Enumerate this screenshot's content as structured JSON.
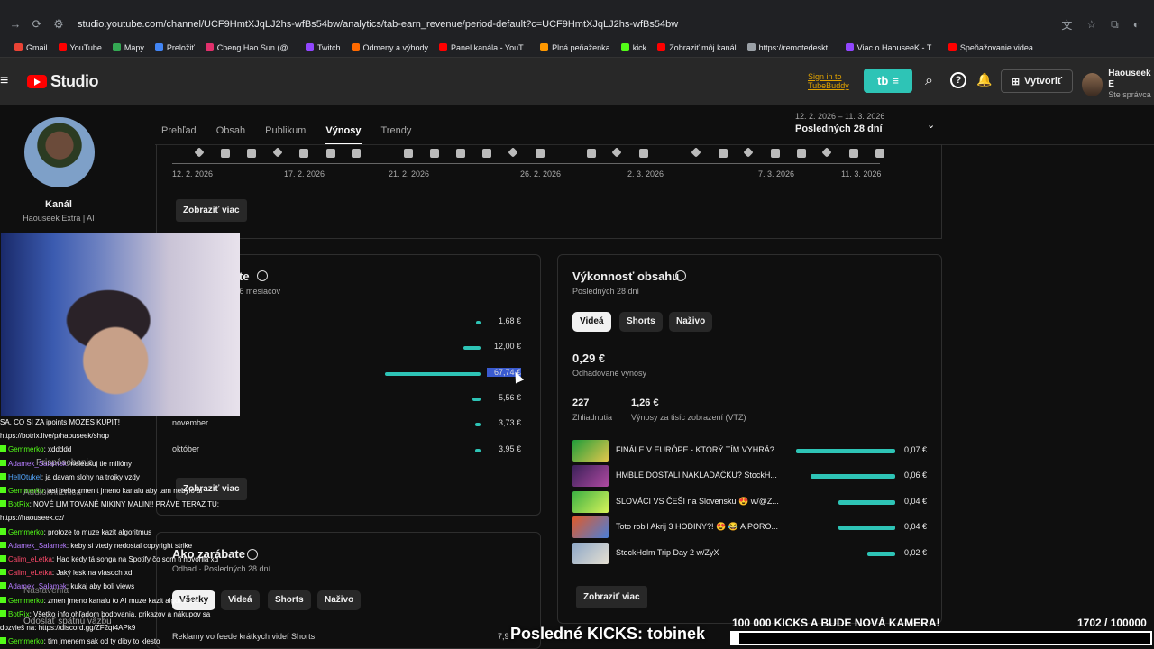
{
  "browser": {
    "url": "studio.youtube.com/channel/UCF9HmtXJqLJ2hs-wfBs54bw/analytics/tab-earn_revenue/period-default?c=UCF9HmtXJqLJ2hs-wfBs54bw",
    "bookmarks": [
      {
        "label": "Gmail",
        "color": "#ea4335"
      },
      {
        "label": "YouTube",
        "color": "#ff0000"
      },
      {
        "label": "Mapy",
        "color": "#34a853"
      },
      {
        "label": "Preložiť",
        "color": "#4285f4"
      },
      {
        "label": "Cheng Hao Sun (@...",
        "color": "#e1306c"
      },
      {
        "label": "Twitch",
        "color": "#9146ff"
      },
      {
        "label": "Odmeny a výhody",
        "color": "#ff6a00"
      },
      {
        "label": "Panel kanála - YouT...",
        "color": "#ff0000"
      },
      {
        "label": "Plná peňaženka",
        "color": "#ff9800"
      },
      {
        "label": "kick",
        "color": "#53fc18"
      },
      {
        "label": "Zobraziť môj kanál",
        "color": "#ff0000"
      },
      {
        "label": "https://remotedeskt...",
        "color": "#9aa0a6"
      },
      {
        "label": "Viac o HaouseeK - T...",
        "color": "#9146ff"
      },
      {
        "label": "Speňažovanie videa...",
        "color": "#ff0000"
      }
    ]
  },
  "header": {
    "brand": "Studio",
    "tubebuddy": "Sign in to TubeBuddy",
    "tb_label": "tb",
    "create_label": "Vytvoriť",
    "account_name": "Haouseek E",
    "account_role": "Ste správca"
  },
  "sidebar": {
    "channel_label": "Kanál",
    "channel_name": "Haouseek Extra | AI"
  },
  "tabs": [
    "Prehľad",
    "Obsah",
    "Publikum",
    "Výnosy",
    "Trendy"
  ],
  "period": {
    "range": "12. 2. 2026 – 11. 3. 2026",
    "label": "Posledných 28 dní"
  },
  "timeline": {
    "ticks": [
      "12. 2. 2026",
      "17. 2. 2026",
      "21. 2. 2026",
      "26. 2. 2026",
      "2. 3. 2026",
      "7. 3. 2026",
      "11. 3. 2026"
    ],
    "more": "Zobraziť viac"
  },
  "revenue_card": {
    "title": "te",
    "subtitle": "h 6 mesiacov",
    "rows": [
      {
        "month": "",
        "value": "1,68 €",
        "amount": 1.68
      },
      {
        "month": "",
        "value": "12,00 €",
        "amount": 12.0
      },
      {
        "month": "",
        "value": "67,74 €",
        "amount": 67.74
      },
      {
        "month": "",
        "value": "5,56 €",
        "amount": 5.56
      },
      {
        "month": "november",
        "value": "3,73 €",
        "amount": 3.73
      },
      {
        "month": "október",
        "value": "3,95 €",
        "amount": 3.95
      }
    ],
    "more": "Zobraziť viac"
  },
  "performance_card": {
    "title": "Výkonnosť obsahu",
    "subtitle": "Posledných 28 dní",
    "chips": [
      "Videá",
      "Shorts",
      "Naživo"
    ],
    "estimated_value": "0,29 €",
    "estimated_label": "Odhadované výnosy",
    "views_value": "227",
    "views_label": "Zhliadnutia",
    "rpm_value": "1,26 €",
    "rpm_label": "Výnosy za tisíc zobrazení (VTZ)",
    "videos": [
      {
        "title": "FINÁLE V EURÓPE - KTORÝ TÍM VYHRÁ? ...",
        "value": "0,07 €",
        "amount": 0.07
      },
      {
        "title": "HMBLE DOSTALI NAKLADAČKU? StockH...",
        "value": "0,06 €",
        "amount": 0.06
      },
      {
        "title": "SLOVÁCI VS ČEŠI na Slovensku 😍 w/@Z...",
        "value": "0,04 €",
        "amount": 0.04
      },
      {
        "title": "Toto robil Akrij 3 HODINY?! 😍 😂 A PORO...",
        "value": "0,04 €",
        "amount": 0.04
      },
      {
        "title": "StockHolm Trip Day 2 w/ZyX",
        "value": "0,02 €",
        "amount": 0.02
      }
    ],
    "more": "Zobraziť viac"
  },
  "earn_card": {
    "title": "Ako zarábate",
    "subtitle": "Odhad · Posledných 28 dní",
    "chips": [
      "Všetky",
      "Videá",
      "Shorts",
      "Naživo"
    ],
    "row_label": "Reklamy vo feede krátkych videí Shorts",
    "row_value": "7,9"
  },
  "chat": [
    {
      "user": "",
      "text": "SA, CO SI ZA ipoints MOZES KUPIT!",
      "color": "#ffffff"
    },
    {
      "user": "",
      "text": "https://botrix.live/p/haouseek/shop",
      "color": "#ffffff"
    },
    {
      "user": "Gemmerko",
      "text": ": xddddd",
      "color": "#53fc18"
    },
    {
      "user": "Adamek_Salamek",
      "text": ": neleakuj tie milióny",
      "color": "#b57cff"
    },
    {
      "user": "HellOtukel",
      "text": ": ja davam slohy na trojky vzdy",
      "color": "#53a7ff"
    },
    {
      "user": "Gemmerko",
      "text": ": asi treba zmenit jmeno kanalu aby tam nebylo ai",
      "color": "#53fc18"
    },
    {
      "user": "BotRix",
      "text": ": NOVÉ LIMITOVANÉ MIKINY MALIN!! PRÁVE TERAZ TU:",
      "color": "#53fc18"
    },
    {
      "user": "",
      "text": "https://haouseek.cz/",
      "color": "#ffffff"
    },
    {
      "user": "Gemmerko",
      "text": ": protoze to muze kazit algoritmus",
      "color": "#53fc18"
    },
    {
      "user": "Adamek_Salamek",
      "text": ": keby si vtedy nedostal copyright strike",
      "color": "#b57cff"
    },
    {
      "user": "Calim_eLetka",
      "text": ": Hao kedy tá songa na Spotify čo som ti hovorila xd",
      "color": "#ff4a6a"
    },
    {
      "user": "Calim_eLetka",
      "text": ": Jaký lesk na vlasoch xd",
      "color": "#ff4a6a"
    },
    {
      "user": "Adamek_Salamek",
      "text": ": kukaj aby boli views",
      "color": "#b57cff"
    },
    {
      "user": "Gemmerko",
      "text": ": zmen jmeno kanalu to AI muze kazit algoritmus",
      "color": "#53fc18"
    },
    {
      "user": "BotRix",
      "text": ": Všetko info ohľadom bodovania, prikazov a nákupov sa",
      "color": "#53fc18"
    },
    {
      "user": "",
      "text": "dozvieš na: https://discord.gg/ZF2qt4APk9",
      "color": "#ffffff"
    },
    {
      "user": "Gemmerko",
      "text": ": tim jmenem sak od ty diby to klesto",
      "color": "#53fc18"
    }
  ],
  "overlay": {
    "left_labels": [
      "Prispôsobenie",
      "Audiokniižnica",
      "Nastavenia",
      "Odoslať spätnú väzbu"
    ],
    "last_kicks": "Posledné KICKS: tobinek",
    "goal_text": "100 000 KICKS A BUDE NOVÁ KAMERA!",
    "goal_count": "1702 / 100000",
    "goal_progress": 0.01702
  },
  "colors": {
    "accent": "#2ec4b6",
    "brand": "#ff0000",
    "background": "#0f0f0f"
  }
}
